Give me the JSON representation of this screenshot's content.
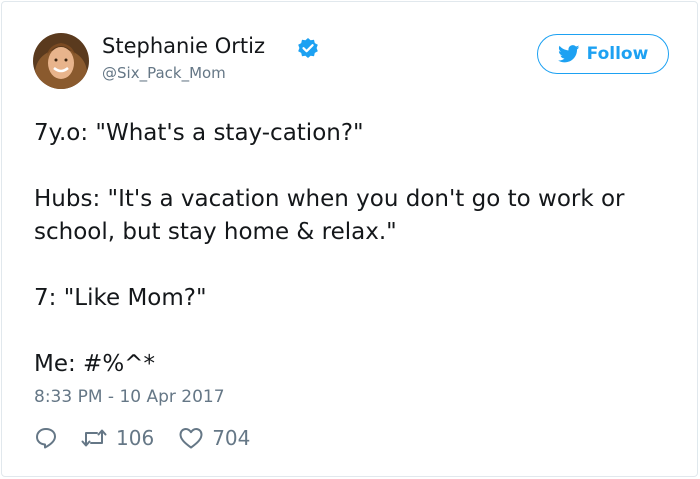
{
  "tweet": {
    "author": {
      "display_name": "Stephanie Ortiz",
      "handle": "@Six_Pack_Mom",
      "verified": true,
      "avatar_icon": "user-avatar"
    },
    "follow_button": {
      "label": "Follow",
      "icon": "twitter-bird-icon"
    },
    "text_paragraphs": [
      "7y.o: \"What's a stay-cation?\"",
      "Hubs: \"It's a vacation when you don't go to work or school, but stay home & relax.\"",
      "7: \"Like Mom?\"",
      "Me: #%^*"
    ],
    "timestamp": "8:33 PM - 10 Apr 2017",
    "actions": {
      "reply_icon": "reply-icon",
      "retweet_icon": "retweet-icon",
      "retweet_count": "106",
      "like_icon": "heart-icon",
      "like_count": "704"
    }
  },
  "colors": {
    "brand_blue": "#1da1f2",
    "text_primary": "#14171a",
    "text_secondary": "#657786",
    "border": "#e1e8ed"
  }
}
